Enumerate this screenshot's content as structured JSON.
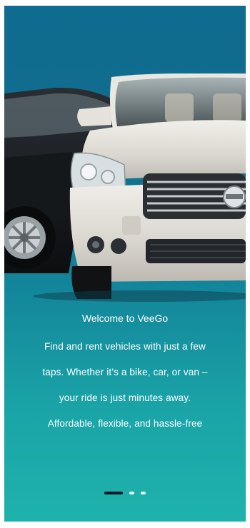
{
  "onboarding": {
    "title": "Welcome to VeeGo",
    "lines": [
      "Find and rent vehicles with just a few",
      "taps. Whether it’s a bike, car, or van –",
      "your ride is just minutes away.",
      "Affordable, flexible, and hassle-free"
    ],
    "page_indicator": {
      "total": 3,
      "active_index": 0
    },
    "hero_image": {
      "brand_badge": "NISSAN",
      "description_icon": "car-image"
    }
  },
  "colors": {
    "gradient_top": "#0f6b8f",
    "gradient_bottom": "#1fb2ac",
    "text": "#ffffff",
    "active_dot": "#0b1b24"
  }
}
